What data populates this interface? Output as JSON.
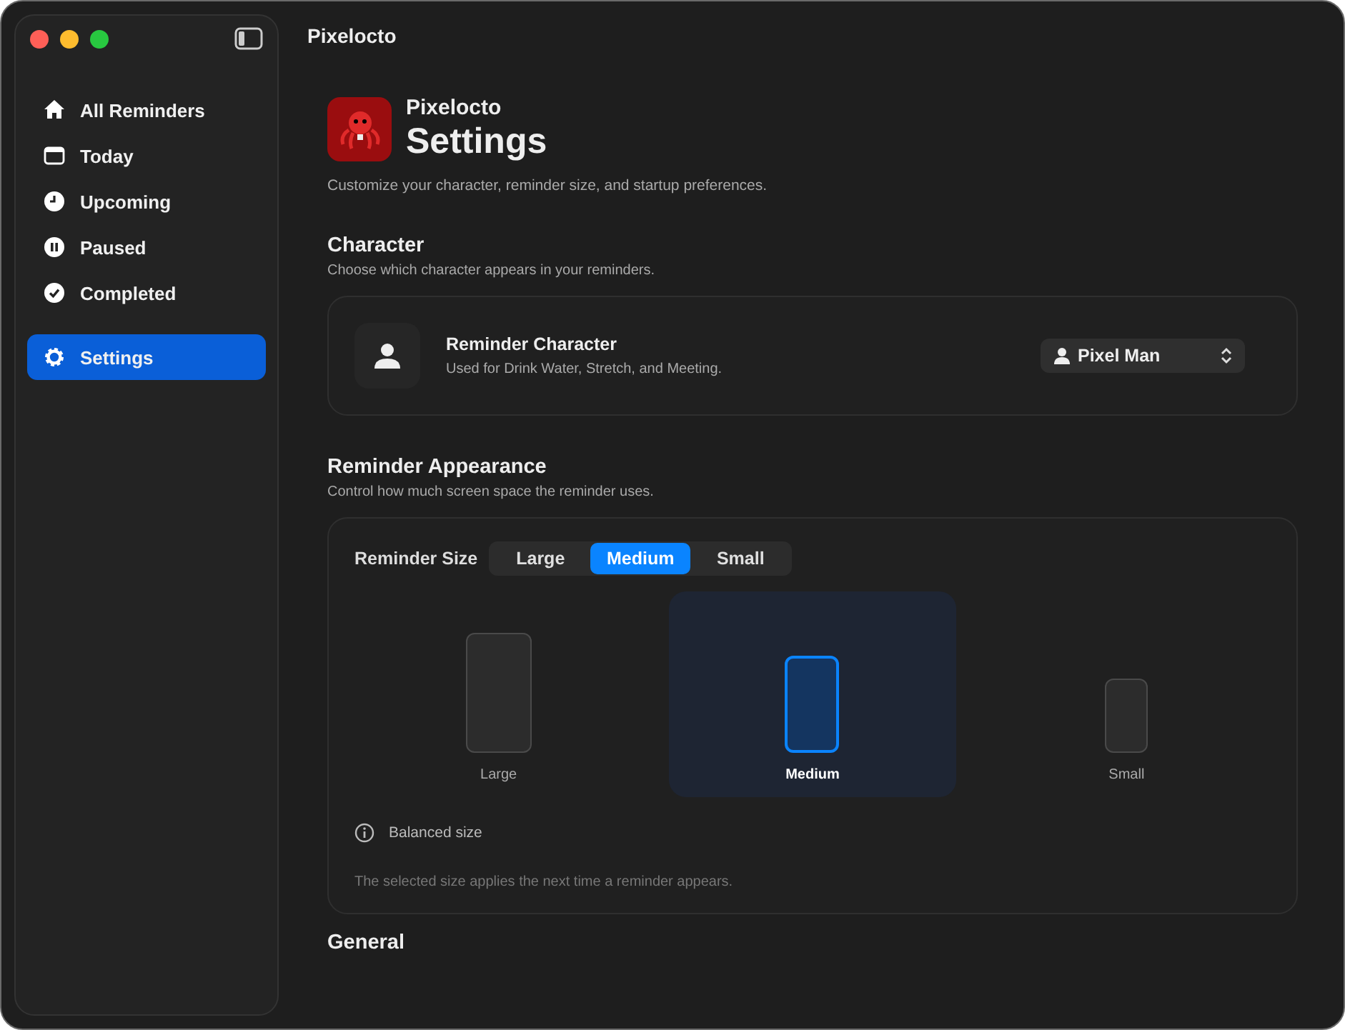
{
  "window": {
    "title": "Pixelocto"
  },
  "sidebar": {
    "items": [
      {
        "label": "All Reminders",
        "selected": false
      },
      {
        "label": "Today",
        "selected": false
      },
      {
        "label": "Upcoming",
        "selected": false
      },
      {
        "label": "Paused",
        "selected": false
      },
      {
        "label": "Completed",
        "selected": false
      },
      {
        "label": "Settings",
        "selected": true
      }
    ]
  },
  "header": {
    "app_name": "Pixelocto",
    "title": "Settings",
    "subtitle": "Customize your character, reminder size, and startup preferences."
  },
  "character": {
    "title": "Character",
    "description": "Choose which character appears in your reminders.",
    "setting": {
      "label": "Reminder Character",
      "description": "Used for Drink Water, Stretch, and Meeting.",
      "value": "Pixel Man"
    }
  },
  "appearance": {
    "title": "Reminder Appearance",
    "description": "Control how much screen space the reminder uses.",
    "size_label": "Reminder Size",
    "segments": [
      {
        "label": "Large",
        "selected": false
      },
      {
        "label": "Medium",
        "selected": true
      },
      {
        "label": "Small",
        "selected": false
      }
    ],
    "previews": [
      {
        "label": "Large",
        "selected": false
      },
      {
        "label": "Medium",
        "selected": true
      },
      {
        "label": "Small",
        "selected": false
      }
    ],
    "info": "Balanced size",
    "note": "The selected size applies the next time a reminder appears."
  },
  "general": {
    "title": "General"
  }
}
